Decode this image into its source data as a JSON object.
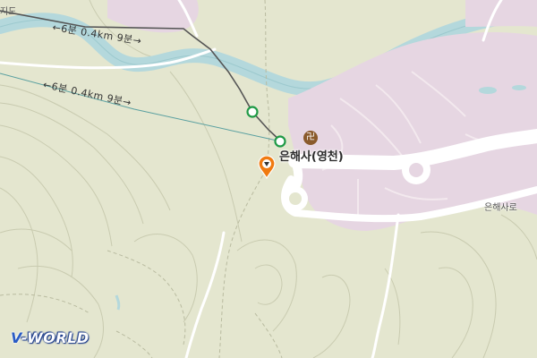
{
  "map": {
    "route_labels": [
      "←6분 0.4km 9분→",
      "←6분 0.4km 9분→"
    ],
    "place_name": "은해사(영천)",
    "place_icon": "temple-icon",
    "place_icon_glyph": "卍",
    "road_name": "은해사로",
    "partial_label": "지도",
    "marker_icon": "location-pin-icon",
    "waypoint_icon": "route-waypoint-icon",
    "brand": {
      "first": "V",
      "rest": "-WORLD"
    },
    "colors": {
      "land": "#e4e6cf",
      "river": "#b4d8dc",
      "temple_area": "#e6d6e2",
      "road": "#ffffff",
      "route_line": "#555555",
      "waypoint": "#1f9a46",
      "marker": "#f07a10"
    }
  }
}
